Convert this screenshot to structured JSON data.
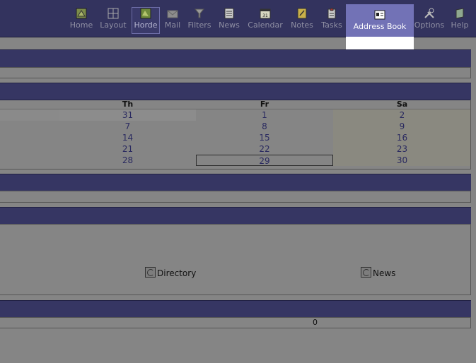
{
  "toolbar": {
    "items": [
      {
        "label": "Home",
        "icon": "home-icon"
      },
      {
        "label": "Layout",
        "icon": "layout-icon"
      },
      {
        "label": "Horde",
        "icon": "horde-icon"
      },
      {
        "label": "Mail",
        "icon": "mail-icon"
      },
      {
        "label": "Filters",
        "icon": "filter-icon"
      },
      {
        "label": "News",
        "icon": "news-icon"
      },
      {
        "label": "Calendar",
        "icon": "calendar-icon"
      },
      {
        "label": "Notes",
        "icon": "notes-icon"
      },
      {
        "label": "Tasks",
        "icon": "tasks-icon"
      },
      {
        "label": "Address Book",
        "icon": "address-book-icon"
      },
      {
        "label": "Options",
        "icon": "options-icon"
      },
      {
        "label": "Help",
        "icon": "help-icon"
      }
    ]
  },
  "calendar": {
    "columns": [
      {
        "day": "Th",
        "dates": [
          "31",
          "7",
          "14",
          "21",
          "28"
        ]
      },
      {
        "day": "Fr",
        "dates": [
          "1",
          "8",
          "15",
          "22",
          "29"
        ]
      },
      {
        "day": "Sa",
        "dates": [
          "2",
          "9",
          "16",
          "23",
          "30"
        ]
      }
    ],
    "today": "29"
  },
  "portal": {
    "radios": [
      {
        "label": "Directory"
      },
      {
        "label": "News"
      }
    ]
  },
  "footer": {
    "count": "0"
  },
  "colors": {
    "toolbar_bg": "#33335e",
    "panel_header": "#363663",
    "selected_tab": "#7272b6",
    "page_bg": "#858585"
  }
}
